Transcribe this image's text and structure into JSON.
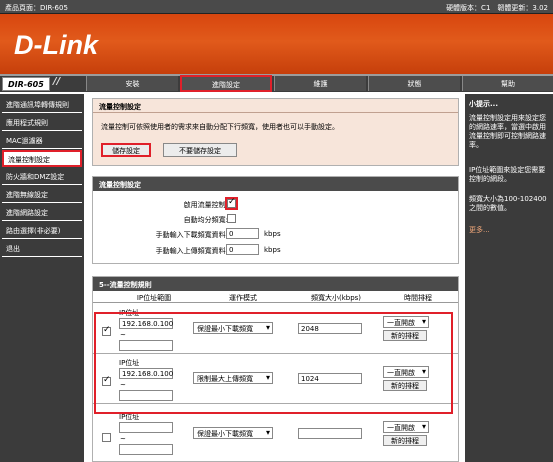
{
  "topbar": {
    "product": "產品頁面：DIR-605",
    "version": "硬體版本：C1　韌體更新：3.02"
  },
  "brand": {
    "logo": "D-Link"
  },
  "nav": {
    "model": "DIR-605",
    "tabs": [
      "安裝",
      "進階設定",
      "維護",
      "狀態",
      "幫助"
    ],
    "active": "進階設定"
  },
  "sidebar": {
    "items": [
      "進階通訊埠轉傳規則",
      "應用程式規則",
      "MAC過濾器",
      "流量控制設定",
      "防火牆和DMZ設定",
      "進階無線設定",
      "進階網路設定",
      "路由選擇(非必要)",
      "退出"
    ],
    "selected": "流量控制設定"
  },
  "main": {
    "section1": {
      "title": "流量控制設定",
      "description": "流量控制可依照使用者的需求來自動分配下行頻寬，使用者也可以手動設定。",
      "save_label": "儲存設定",
      "nosave_label": "不要儲存設定"
    },
    "section2": {
      "title": "流量控制設定",
      "enable_label": "啟用流量控制:",
      "enable_checked": true,
      "auto_label": "自動均分頻寬:",
      "auto_checked": false,
      "download_label": "手動輸入下載頻寬資料:",
      "download_value": "0",
      "upload_label": "手動輸入上傳頻寬資料:",
      "upload_value": "0",
      "unit": "kbps"
    },
    "section3": {
      "title": "5--流量控制規則",
      "headers": [
        "IP位址範圍",
        "運作模式",
        "頻寬大小(kbps)",
        "時間排程"
      ],
      "rows": [
        {
          "checked": true,
          "ip_label": "IP位址",
          "ip_start": "192.168.0.100",
          "tilde": "~",
          "ip_end": "",
          "mode": "保證最小下載頻寬",
          "bandwidth": "2048",
          "schedule": "一直開啟",
          "new_schedule": "新的排程"
        },
        {
          "checked": true,
          "ip_label": "IP位址",
          "ip_start": "192.168.0.100",
          "tilde": "~",
          "ip_end": "",
          "mode": "限制最大上傳頻寬",
          "bandwidth": "1024",
          "schedule": "一直開啟",
          "new_schedule": "新的排程"
        },
        {
          "checked": false,
          "ip_label": "IP位址",
          "ip_start": "",
          "tilde": "~",
          "ip_end": "",
          "mode": "保證最小下載頻寬",
          "bandwidth": "",
          "schedule": "一直開啟",
          "new_schedule": "新的排程"
        }
      ]
    }
  },
  "help": {
    "title": "小提示...",
    "p1": "流量控制設定用來設定您的網路速率，當選中啟用流量控制即可控制網路速率。",
    "p2": "IP位址範圍來設定您需要控制的網段。",
    "p3": "頻寬大小為100-102400之間的數值。",
    "more": "更多..."
  },
  "colors": {
    "brand_orange": "#e15a1b",
    "highlight_red": "#e0202a",
    "nav_dark": "#3b3b3b"
  }
}
